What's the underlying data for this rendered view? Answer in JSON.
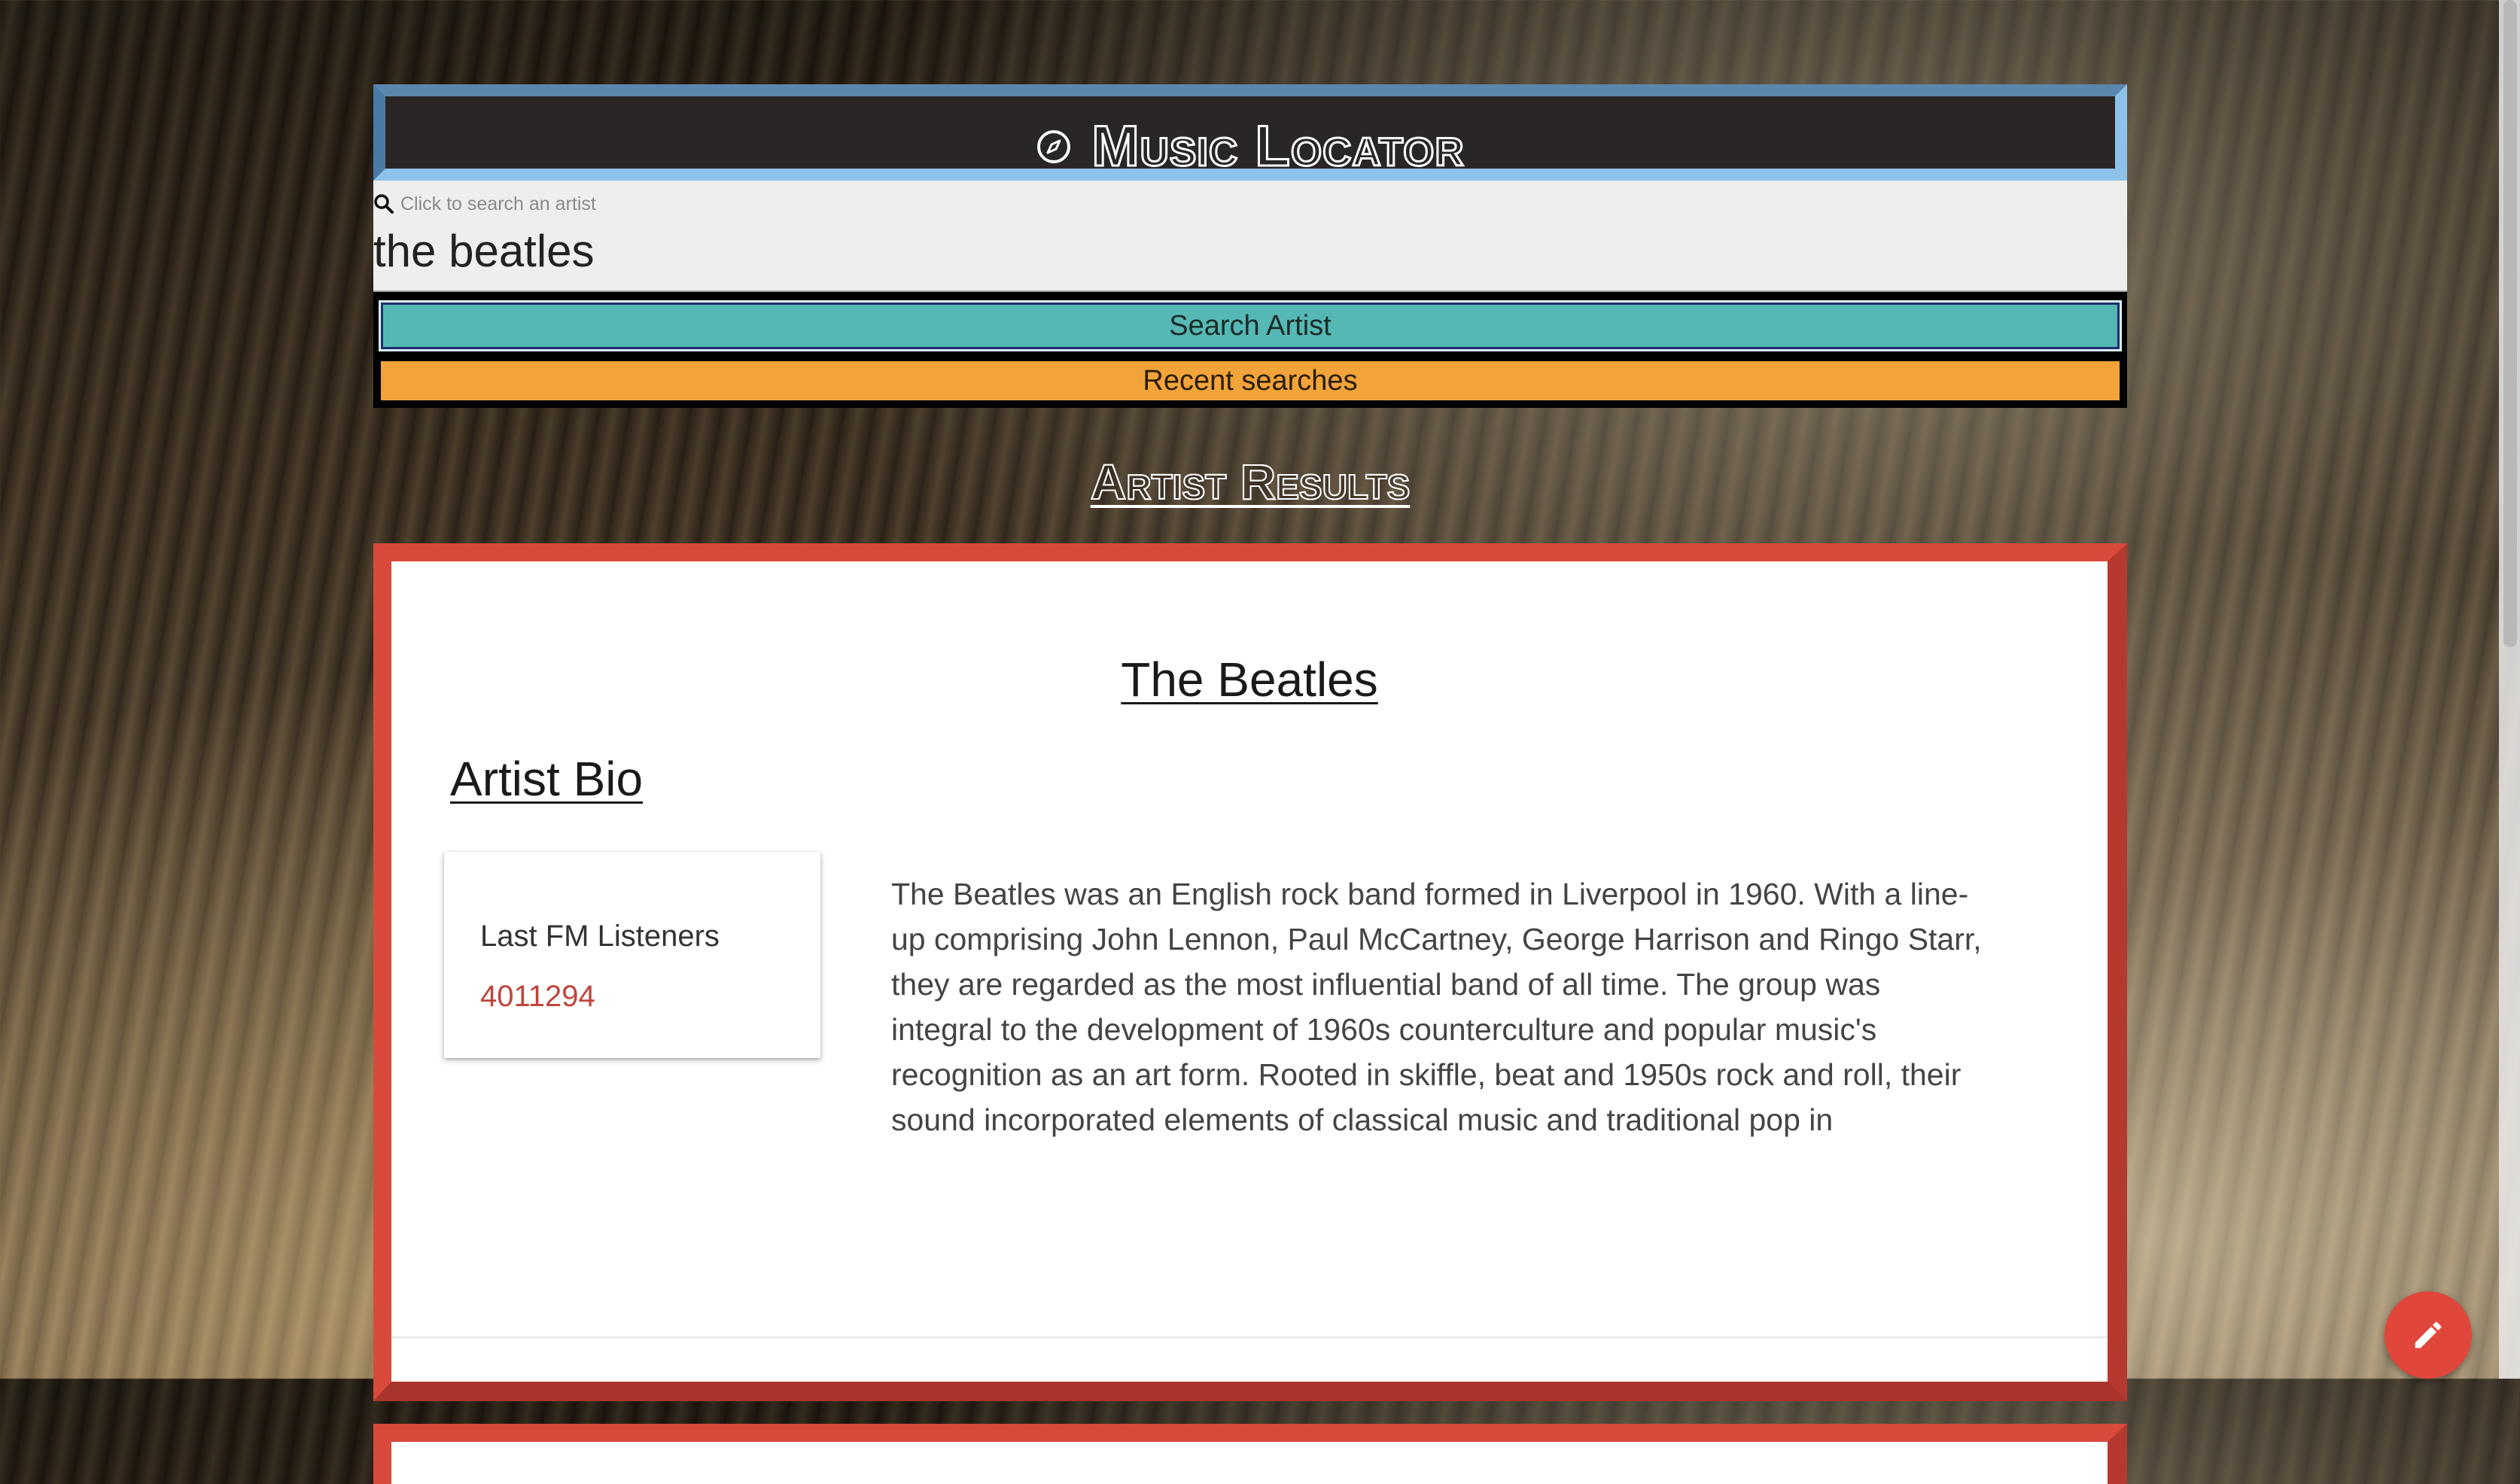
{
  "header": {
    "app_title": "Music Locator",
    "icon": "compass-icon"
  },
  "search": {
    "label": "Click to search an artist",
    "value": "the beatles",
    "icon": "search-icon"
  },
  "buttons": {
    "search_artist": "Search Artist",
    "recent_searches": "Recent searches"
  },
  "results": {
    "heading": "Artist Results",
    "artist": {
      "name": "The Beatles",
      "bio_heading": "Artist Bio",
      "listeners_label": "Last FM Listeners",
      "listeners_value": "4011294",
      "bio": "The Beatles was an English rock band formed in Liverpool in 1960. With a line-up comprising John Lennon, Paul McCartney, George Harrison and Ringo Starr, they are regarded as the most influential band of all time. The group was integral to the development of 1960s counterculture and popular music's recognition as an art form. Rooted in skiffle, beat and 1950s rock and roll, their sound incorporated elements of classical music and traditional pop in"
    }
  },
  "fab": {
    "icon": "pencil-icon"
  },
  "colors": {
    "title_bg": "#2a2626",
    "search_button": "#55b8b4",
    "recent_button": "#f2a43a",
    "card_border": "#d94a3d",
    "listeners_value": "#c0443a",
    "fab": "#e0463a"
  }
}
